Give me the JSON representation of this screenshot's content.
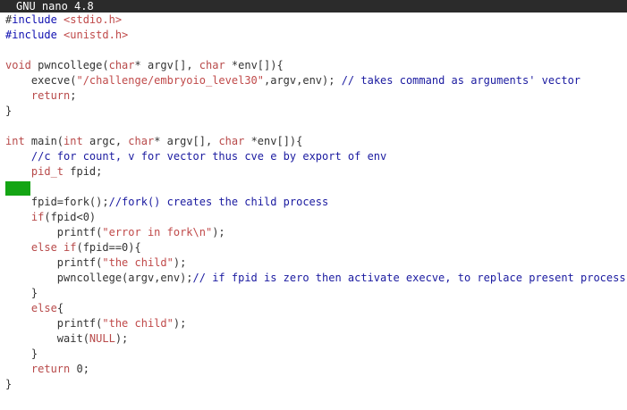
{
  "window": {
    "title": "GNU nano 4.8"
  },
  "editor": {
    "lines": [
      [
        {
          "t": "#",
          "c": "def"
        },
        {
          "t": "include ",
          "c": "dir"
        },
        {
          "t": "<stdio.h>",
          "c": "str"
        }
      ],
      [
        {
          "t": "#include ",
          "c": "dir"
        },
        {
          "t": "<unistd.h>",
          "c": "str"
        }
      ],
      [],
      [
        {
          "t": "void ",
          "c": "key"
        },
        {
          "t": "pwncollege(",
          "c": "def"
        },
        {
          "t": "char",
          "c": "key"
        },
        {
          "t": "* argv[], ",
          "c": "def"
        },
        {
          "t": "char",
          "c": "key"
        },
        {
          "t": " *env[]){",
          "c": "def"
        }
      ],
      [
        {
          "t": "    execve(",
          "c": "def"
        },
        {
          "t": "\"/challenge/embryoio_level30\"",
          "c": "str"
        },
        {
          "t": ",argv,env); ",
          "c": "def"
        },
        {
          "t": "// takes command as arguments' vector",
          "c": "com"
        }
      ],
      [
        {
          "t": "    ",
          "c": "def"
        },
        {
          "t": "return",
          "c": "key"
        },
        {
          "t": ";",
          "c": "def"
        }
      ],
      [
        {
          "t": "}",
          "c": "def"
        }
      ],
      [],
      [
        {
          "t": "int ",
          "c": "key"
        },
        {
          "t": "main(",
          "c": "def"
        },
        {
          "t": "int ",
          "c": "key"
        },
        {
          "t": "argc, ",
          "c": "def"
        },
        {
          "t": "char",
          "c": "key"
        },
        {
          "t": "* argv[], ",
          "c": "def"
        },
        {
          "t": "char",
          "c": "key"
        },
        {
          "t": " *env[]){",
          "c": "def"
        }
      ],
      [
        {
          "t": "    ",
          "c": "def"
        },
        {
          "t": "//c for count, v for vector thus cve e by export of env",
          "c": "com"
        }
      ],
      [
        {
          "t": "    ",
          "c": "def"
        },
        {
          "t": "pid_t",
          "c": "key"
        },
        {
          "t": " fpid;",
          "c": "def"
        }
      ],
      [],
      [
        {
          "t": "    fpid=fork();",
          "c": "def"
        },
        {
          "t": "//fork() creates the child process",
          "c": "com"
        }
      ],
      [
        {
          "t": "    ",
          "c": "def"
        },
        {
          "t": "if",
          "c": "key"
        },
        {
          "t": "(fpid<0)",
          "c": "def"
        }
      ],
      [
        {
          "t": "        printf(",
          "c": "def"
        },
        {
          "t": "\"error in fork\\n\"",
          "c": "str"
        },
        {
          "t": ");",
          "c": "def"
        }
      ],
      [
        {
          "t": "    ",
          "c": "def"
        },
        {
          "t": "else if",
          "c": "key"
        },
        {
          "t": "(fpid==0){",
          "c": "def"
        }
      ],
      [
        {
          "t": "        printf(",
          "c": "def"
        },
        {
          "t": "\"the child\"",
          "c": "str"
        },
        {
          "t": ");",
          "c": "def"
        }
      ],
      [
        {
          "t": "        pwncollege(argv,env);",
          "c": "def"
        },
        {
          "t": "// if fpid is zero then activate execve, to replace present process",
          "c": "com"
        }
      ],
      [
        {
          "t": "    }",
          "c": "def"
        }
      ],
      [
        {
          "t": "    ",
          "c": "def"
        },
        {
          "t": "else",
          "c": "key"
        },
        {
          "t": "{",
          "c": "def"
        }
      ],
      [
        {
          "t": "        printf(",
          "c": "def"
        },
        {
          "t": "\"the child\"",
          "c": "str"
        },
        {
          "t": ");",
          "c": "def"
        }
      ],
      [
        {
          "t": "        wait(",
          "c": "def"
        },
        {
          "t": "NULL",
          "c": "key"
        },
        {
          "t": ");",
          "c": "def"
        }
      ],
      [
        {
          "t": "    }",
          "c": "def"
        }
      ],
      [
        {
          "t": "    ",
          "c": "def"
        },
        {
          "t": "return ",
          "c": "key"
        },
        {
          "t": "0;",
          "c": "def"
        }
      ],
      [
        {
          "t": "}",
          "c": "def"
        }
      ]
    ]
  },
  "colors": {
    "titlebar_bg": "#2b2b2b",
    "cursor": "#14a514",
    "directive": "#0f0fb0",
    "string": "#c04a4a",
    "keyword": "#b84a4a",
    "comment": "#1a1aa0"
  }
}
